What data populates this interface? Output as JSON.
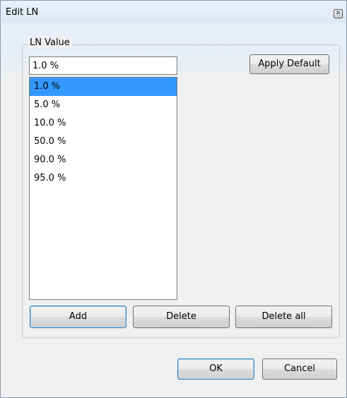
{
  "window": {
    "title": "Edit LN",
    "close_icon": "close-icon"
  },
  "group": {
    "label": "LN Value"
  },
  "input": {
    "value": "1.0 %"
  },
  "list": {
    "items": [
      "1.0 %",
      "5.0 %",
      "10.0 %",
      "50.0 %",
      "90.0 %",
      "95.0 %"
    ],
    "selected_index": 0
  },
  "buttons": {
    "apply_default": "Apply Default",
    "add": "Add",
    "delete": "Delete",
    "delete_all": "Delete all",
    "ok": "OK",
    "cancel": "Cancel"
  },
  "colors": {
    "selection": "#3399ff",
    "titlebar": "#dce7f3"
  }
}
